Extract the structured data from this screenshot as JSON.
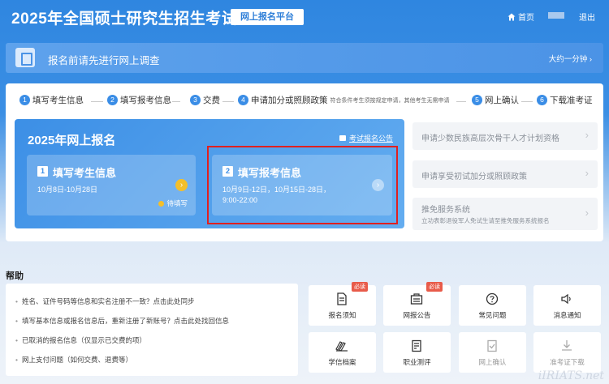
{
  "header": {
    "title": "2025年全国硕士研究生招生考试",
    "platform": "网上报名平台",
    "home": "首页",
    "logout": "退出"
  },
  "survey": {
    "text": "报名前请先进行网上调查",
    "right": "大约一分钟 ›"
  },
  "steps": [
    {
      "num": "1",
      "label": "填写考生信息"
    },
    {
      "num": "2",
      "label": "填写报考信息"
    },
    {
      "num": "3",
      "label": "交费"
    },
    {
      "num": "4",
      "label": "申请加分或照顾政策",
      "sub": "符合条件考生须按规定申请，其他考生无需申请"
    },
    {
      "num": "5",
      "label": "网上确认"
    },
    {
      "num": "6",
      "label": "下载准考证"
    }
  ],
  "registration": {
    "title": "2025年网上报名",
    "announcement": "考试报名公告",
    "box1": {
      "num": "1",
      "title": "填写考生信息",
      "date": "10月8日-10月28日",
      "status": "待填写"
    },
    "box2": {
      "num": "2",
      "title": "填写报考信息",
      "date_line1": "10月9日-12日，10月15日-28日，",
      "date_line2": "9:00-22:00"
    }
  },
  "side": [
    {
      "label": "申请少数民族高层次骨干人才计划资格"
    },
    {
      "label": "申请享受初试加分或照顾政策"
    },
    {
      "label": "推免服务系统",
      "sub": "立功表彰退役军人免试生请至推免服务系统报名"
    }
  ],
  "help": {
    "title": "帮助",
    "items": [
      "姓名、证件号码等信息和实名注册不一致？点击此处同步",
      "填写基本信息或报名信息后，重新注册了新账号？点击此处找回信息",
      "已取消的报名信息（仅显示已交费的项）",
      "网上支付问题（如何交费、退费等）"
    ]
  },
  "tiles": [
    {
      "label": "报名须知",
      "badge": "必读",
      "icon": "document-icon"
    },
    {
      "label": "网报公告",
      "badge": "必读",
      "icon": "announcement-icon"
    },
    {
      "label": "常见问题",
      "icon": "question-icon"
    },
    {
      "label": "消息通知",
      "icon": "speaker-icon"
    },
    {
      "label": "学信档案",
      "icon": "book-icon"
    },
    {
      "label": "职业测评",
      "icon": "evaluation-icon"
    },
    {
      "label": "网上确认",
      "icon": "confirm-icon"
    },
    {
      "label": "准考证下载",
      "icon": "download-icon"
    }
  ],
  "watermark": "iIRIATS.net"
}
